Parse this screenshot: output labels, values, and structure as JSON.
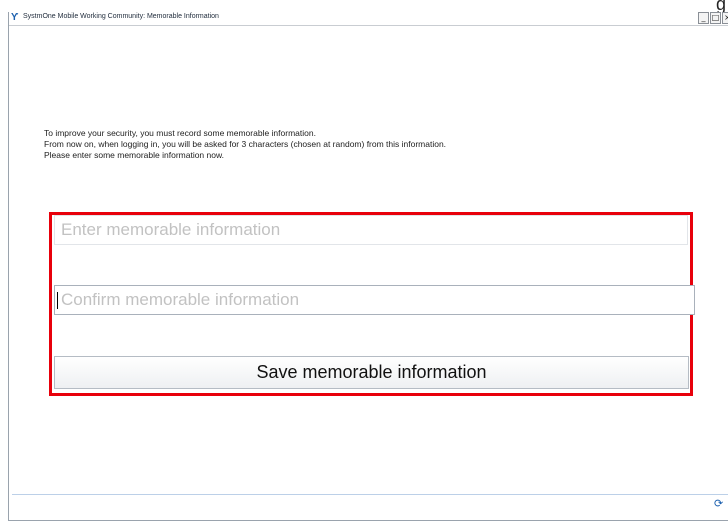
{
  "corner_glyph": "g",
  "window": {
    "title": "SystmOne Mobile Working Community: Memorable Information",
    "controls": {
      "minimize": "_",
      "maximize": "□",
      "close": "×"
    }
  },
  "intro": {
    "line1": "To improve your security, you must record some memorable information.",
    "line2": "From now on, when logging in, you will be asked for 3 characters (chosen at random) from this information.",
    "line3": "Please enter some memorable information now."
  },
  "form": {
    "memorable_placeholder": "Enter memorable information",
    "memorable_value": "",
    "confirm_placeholder": "Confirm memorable information",
    "confirm_value": "",
    "save_label": "Save memorable information"
  },
  "colors": {
    "highlight": "#e8000b",
    "accent": "#1b5fae"
  },
  "icons": {
    "app": "systmone-app-icon",
    "status": "refresh-icon"
  }
}
